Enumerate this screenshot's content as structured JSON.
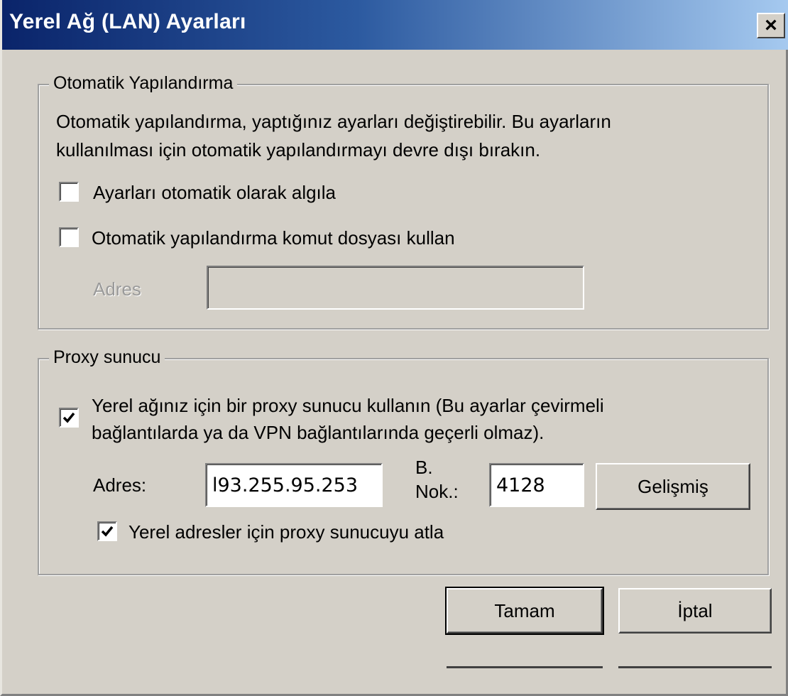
{
  "window": {
    "title": "Yerel Ağ (LAN) Ayarları",
    "close_label": "×"
  },
  "auto_config": {
    "legend": "Otomatik Yapılandırma",
    "description_line1": "Otomatik yapılandırma, yaptığınız ayarları değiştirebilir. Bu ayarların",
    "description_line2": "kullanılması için otomatik yapılandırmayı devre dışı bırakın.",
    "detect_label": "Ayarları otomatik olarak algıla",
    "detect_checked": false,
    "script_label": "Otomatik yapılandırma komut dosyası kullan",
    "script_checked": false,
    "address_label": "Adres",
    "address_value": ""
  },
  "proxy": {
    "legend": "Proxy sunucu",
    "use_proxy_line1": "Yerel ağınız için bir proxy sunucu kullanın (Bu ayarlar çevirmeli",
    "use_proxy_line2": "bağlantılarda ya da VPN bağlantılarında geçerli olmaz).",
    "use_proxy_checked": true,
    "address_label": "Adres:",
    "address_value": "l93.255.95.253",
    "port_label_line1": "B.",
    "port_label_line2": "Nok.:",
    "port_value": "4128",
    "advanced_label": "Gelişmiş",
    "bypass_label": "Yerel adresler için proxy sunucuyu atla",
    "bypass_checked": true
  },
  "buttons": {
    "ok_label": "Tamam",
    "cancel_label": "İptal"
  }
}
